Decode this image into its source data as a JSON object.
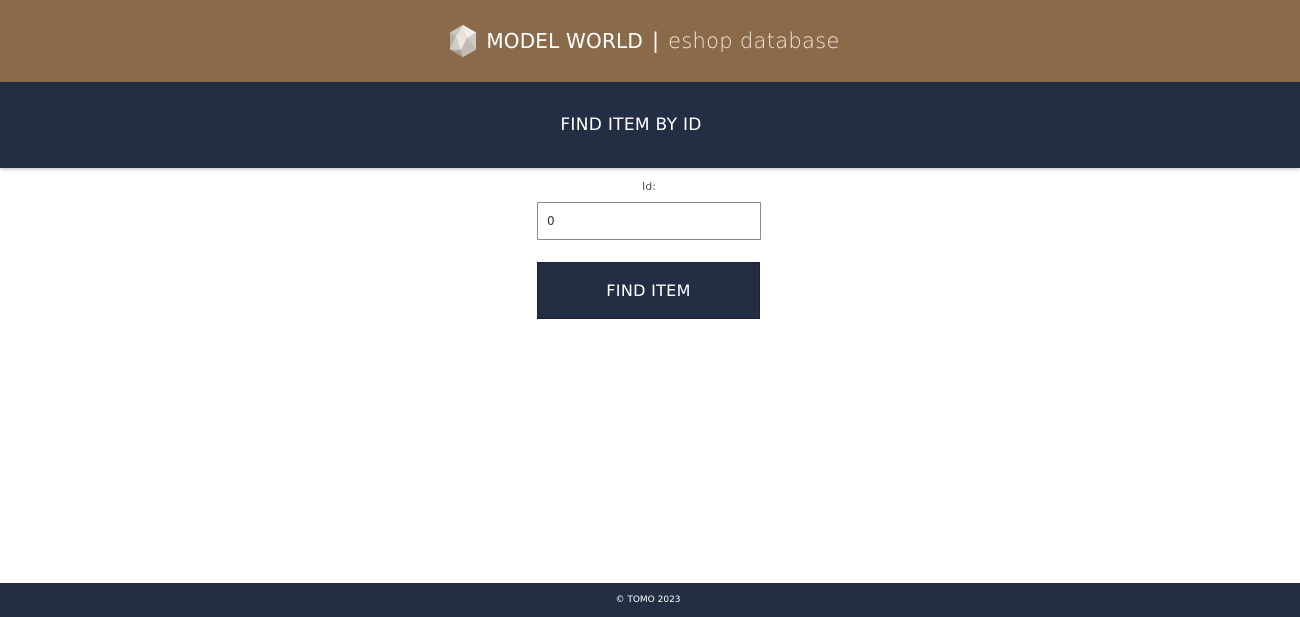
{
  "header": {
    "brand_name": "MODEL WORLD",
    "separator": "|",
    "brand_subtitle": "eshop database",
    "logo_icon": "polyhedron-logo-icon",
    "background_color": "#8b6a4a"
  },
  "title_bar": {
    "title": "FIND ITEM BY ID",
    "background_color": "#232d43"
  },
  "form": {
    "id_label": "Id:",
    "id_value": "0",
    "submit_label": "FIND ITEM"
  },
  "footer": {
    "copyright": "© TOMO 2023"
  }
}
